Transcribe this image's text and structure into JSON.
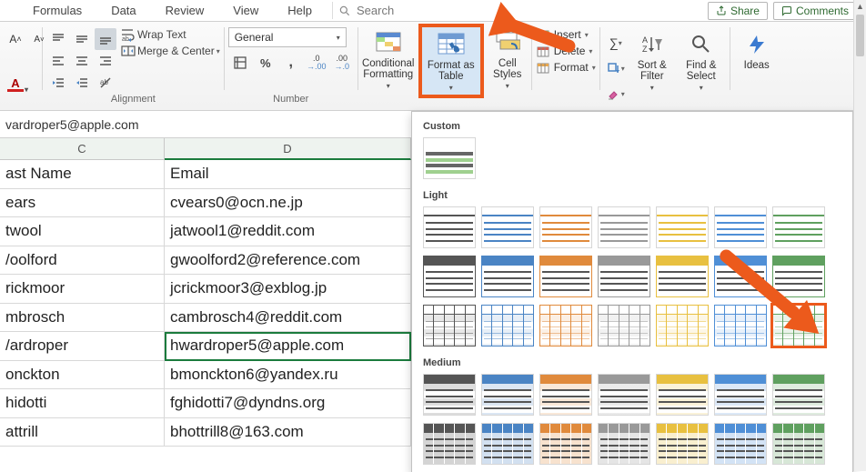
{
  "tabs": {
    "formulas": "Formulas",
    "data": "Data",
    "review": "Review",
    "view": "View",
    "help": "Help"
  },
  "search": {
    "placeholder": "Search"
  },
  "actions": {
    "share": "Share",
    "comments": "Comments"
  },
  "ribbon": {
    "alignment_label": "Alignment",
    "wrap_text": "Wrap Text",
    "merge_center": "Merge & Center",
    "number_label": "Number",
    "number_format": "General",
    "conditional_formatting": "Conditional Formatting",
    "format_as_table": "Format as Table",
    "cell_styles": "Cell Styles",
    "cells": {
      "insert": "Insert",
      "delete": "Delete",
      "format": "Format"
    },
    "editing": {
      "sort_filter": "Sort & Filter",
      "find_select": "Find & Select"
    },
    "ideas": "Ideas"
  },
  "formula_bar": {
    "value": "vardroper5@apple.com"
  },
  "columns": {
    "c": "C",
    "d": "D"
  },
  "headers": {
    "last_name": "ast Name",
    "email": "Email"
  },
  "rows": [
    {
      "last_name": "ears",
      "email": "cvears0@ocn.ne.jp"
    },
    {
      "last_name": "twool",
      "email": "jatwool1@reddit.com"
    },
    {
      "last_name": "/oolford",
      "email": "gwoolford2@reference.com"
    },
    {
      "last_name": "rickmoor",
      "email": "jcrickmoor3@exblog.jp"
    },
    {
      "last_name": "mbrosch",
      "email": "cambrosch4@reddit.com"
    },
    {
      "last_name": "/ardroper",
      "email": "hwardroper5@apple.com"
    },
    {
      "last_name": "onckton",
      "email": "bmonckton6@yandex.ru"
    },
    {
      "last_name": "hidotti",
      "email": "fghidotti7@dyndns.org"
    },
    {
      "last_name": "attrill",
      "email": "bhottrill8@163.com"
    }
  ],
  "active_row": 5,
  "gallery": {
    "sections": {
      "custom": "Custom",
      "light": "Light",
      "medium": "Medium"
    },
    "palette": [
      "#555555",
      "#4a84c4",
      "#e08a3c",
      "#999999",
      "#e8c040",
      "#4f8fd6",
      "#5fa05f"
    ]
  }
}
